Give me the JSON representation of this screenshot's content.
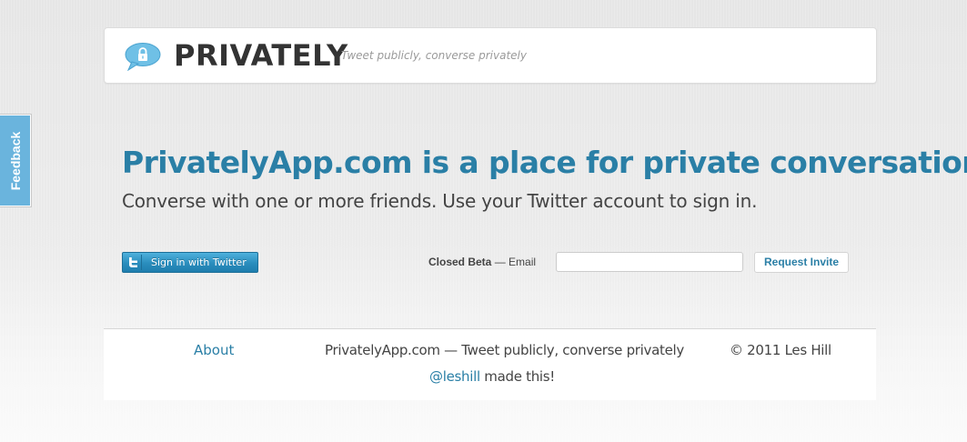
{
  "feedback_tab": {
    "label": "Feedback"
  },
  "header": {
    "brand": "PRIVATELY",
    "tagline": "Tweet publicly, converse privately",
    "logo_icon": "speech-bubble-lock-icon"
  },
  "hero": {
    "title": "PrivatelyApp.com is a place for private conversation",
    "subtitle": "Converse with one or more friends. Use your Twitter account to sign in."
  },
  "signin": {
    "label": "Sign in with Twitter",
    "icon": "twitter-bird-icon"
  },
  "beta_form": {
    "closed_beta": "Closed Beta",
    "dash": " — ",
    "email_label": "Email",
    "email_value": "",
    "request_button": "Request Invite"
  },
  "footer": {
    "about": "About",
    "tagline": "PrivatelyApp.com — Tweet publicly, converse privately",
    "copyright": "© 2011 Les Hill",
    "credit_handle": "@leshill",
    "credit_text": " made this!"
  },
  "colors": {
    "accent": "#2a7fa6",
    "feedback": "#6ab4dd",
    "twitter_button": "#2a8dbd",
    "text": "#444444"
  }
}
